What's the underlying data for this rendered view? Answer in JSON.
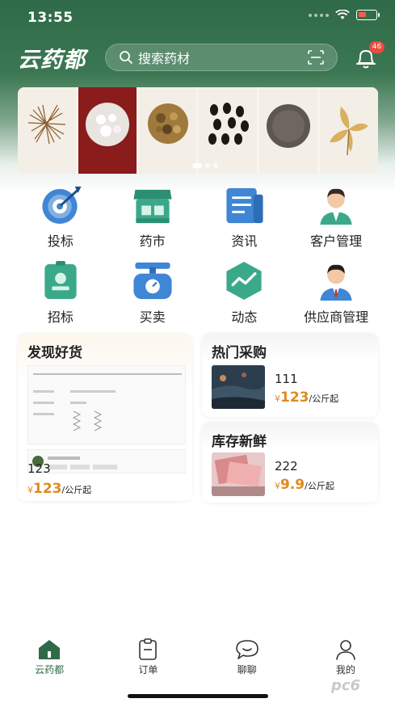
{
  "status_bar": {
    "time": "13:55"
  },
  "header": {
    "brand": "云药都",
    "search_placeholder": "搜索药材",
    "notification_count": "46",
    "icons": {
      "search": "search-icon",
      "scan": "scan-icon",
      "bell": "bell-icon"
    }
  },
  "banner": {
    "herbs": [
      "herb-1",
      "herb-2",
      "herb-3",
      "herb-4",
      "herb-5",
      "herb-6"
    ],
    "active_page": 0,
    "page_count": 3
  },
  "menu": [
    {
      "label": "投标",
      "icon": "target-icon",
      "color": "#3f86d4"
    },
    {
      "label": "药市",
      "icon": "shop-icon",
      "color": "#3aa98a"
    },
    {
      "label": "资讯",
      "icon": "news-icon",
      "color": "#3f86d4"
    },
    {
      "label": "客户管理",
      "icon": "person-icon",
      "color": "#3aa98a"
    },
    {
      "label": "招标",
      "icon": "badge-icon",
      "color": "#3aa98a"
    },
    {
      "label": "买卖",
      "icon": "scale-icon",
      "color": "#3f86d4"
    },
    {
      "label": "动态",
      "icon": "trend-icon",
      "color": "#3aa98a"
    },
    {
      "label": "供应商管理",
      "icon": "manager-icon",
      "color": "#3f86d4"
    }
  ],
  "cards": {
    "discover": {
      "title": "发现好货",
      "name": "123",
      "currency": "¥",
      "price": "123",
      "unit": "/公斤起"
    },
    "hot": {
      "title": "热门采购",
      "name": "111",
      "currency": "¥",
      "price": "123",
      "unit": "/公斤起"
    },
    "fresh": {
      "title": "库存新鲜",
      "name": "222",
      "currency": "¥",
      "price": "9.9",
      "unit": "/公斤起"
    }
  },
  "tabbar": [
    {
      "label": "云药都",
      "icon": "home-icon",
      "active": true
    },
    {
      "label": "订单",
      "icon": "order-icon",
      "active": false
    },
    {
      "label": "聊聊",
      "icon": "chat-icon",
      "active": false
    },
    {
      "label": "我的",
      "icon": "profile-icon",
      "active": false
    }
  ],
  "colors": {
    "brand_green": "#2f6a48",
    "price_orange": "#e08a1e",
    "badge_red": "#e94b3c"
  }
}
